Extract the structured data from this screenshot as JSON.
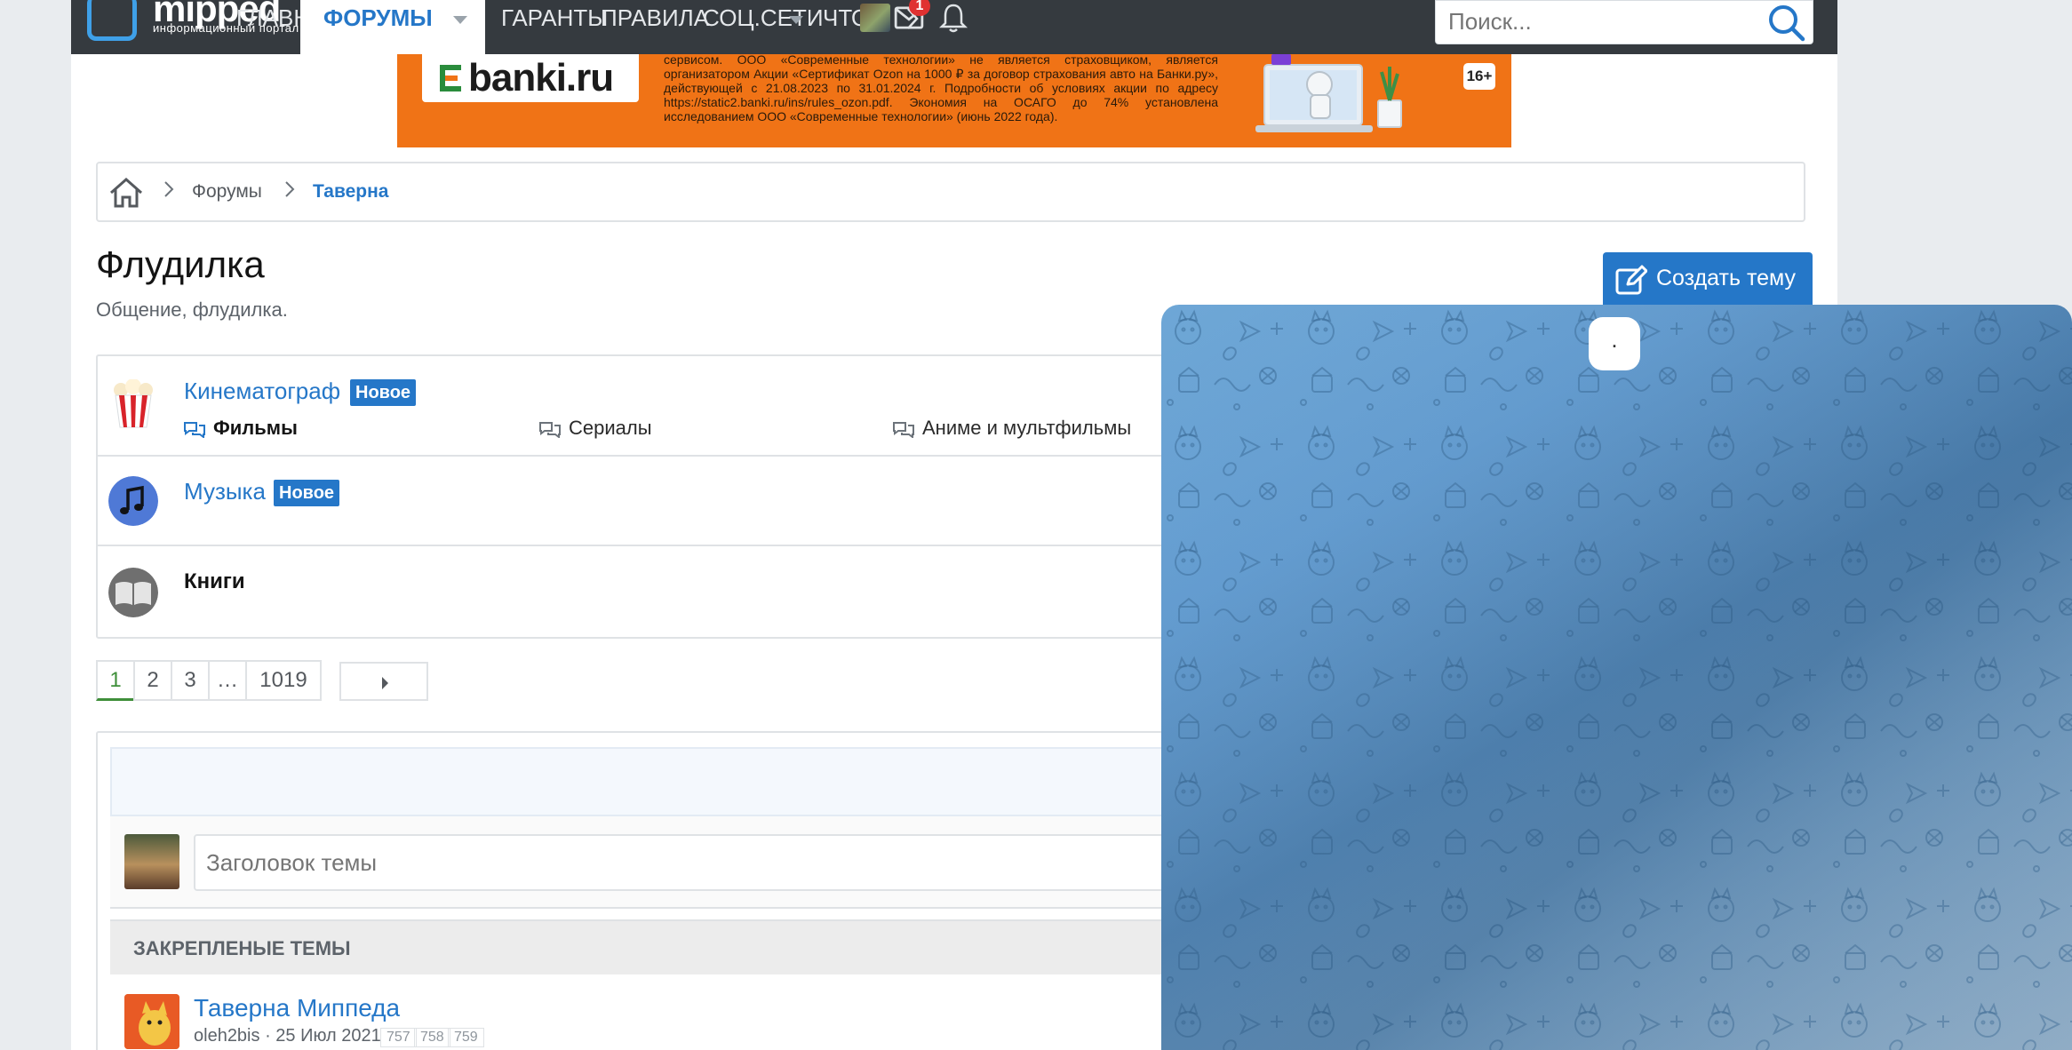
{
  "nav": {
    "logo_word": "mipped",
    "logo_sub": "информационный портал",
    "tabs": [
      "Главная",
      "Форумы",
      "Гаранты",
      "Правила",
      "Соц.сети",
      "Что нов"
    ],
    "active_tab": "Форумы",
    "mail_badge": "1",
    "search_placeholder": "Поиск..."
  },
  "ad": {
    "brand": "banki.ru",
    "legal_text": "сервисом. ООО «Современные технологии» не является страховщиком, является организатором Акции «Сертификат Ozon на 1000 ₽ за договор страхования авто на Банки.ру», действующей с 21.08.2023 по 31.01.2024 г. Подробности об условиях акции по адресу https://static2.banki.ru/ins/rules_ozon.pdf. Экономия на ОСАГО до 74% установлена исследованием ООО «Современные технологии» (июнь 2022 года).",
    "age_rating": "16+"
  },
  "breadcrumb": {
    "items": [
      "Форумы",
      "Таверна"
    ]
  },
  "page": {
    "title": "Флудилка",
    "description": "Общение, флудилка.",
    "create_topic_label": "Создать тему"
  },
  "subforums": [
    {
      "title": "Кинематограф",
      "badge": "Новое",
      "children": [
        "Фильмы",
        "Сериалы",
        "Аниме и мультфильмы"
      ]
    },
    {
      "title": "Музыка",
      "badge": "Новое",
      "children": []
    },
    {
      "title": "Книги",
      "badge": "",
      "children": []
    }
  ],
  "pagination": {
    "pages": [
      "1",
      "2",
      "3",
      "…",
      "1019"
    ],
    "current": "1"
  },
  "quick_thread": {
    "title_placeholder": "Заголовок темы"
  },
  "pinned": {
    "header": "Закрепленые темы",
    "topics": [
      {
        "title": "Таверна Миппеда",
        "author": "oleh2bis",
        "date": "25 Июл 2021",
        "pages": [
          "757",
          "758",
          "759"
        ]
      }
    ]
  },
  "chat_widget": {
    "date_pill": "."
  },
  "colors": {
    "accent": "#2577c8",
    "nav_bg": "#353a3f",
    "ad_bg": "#f07316",
    "badge_mail": "#e03131",
    "pagination_active": "#3f8f3a"
  }
}
